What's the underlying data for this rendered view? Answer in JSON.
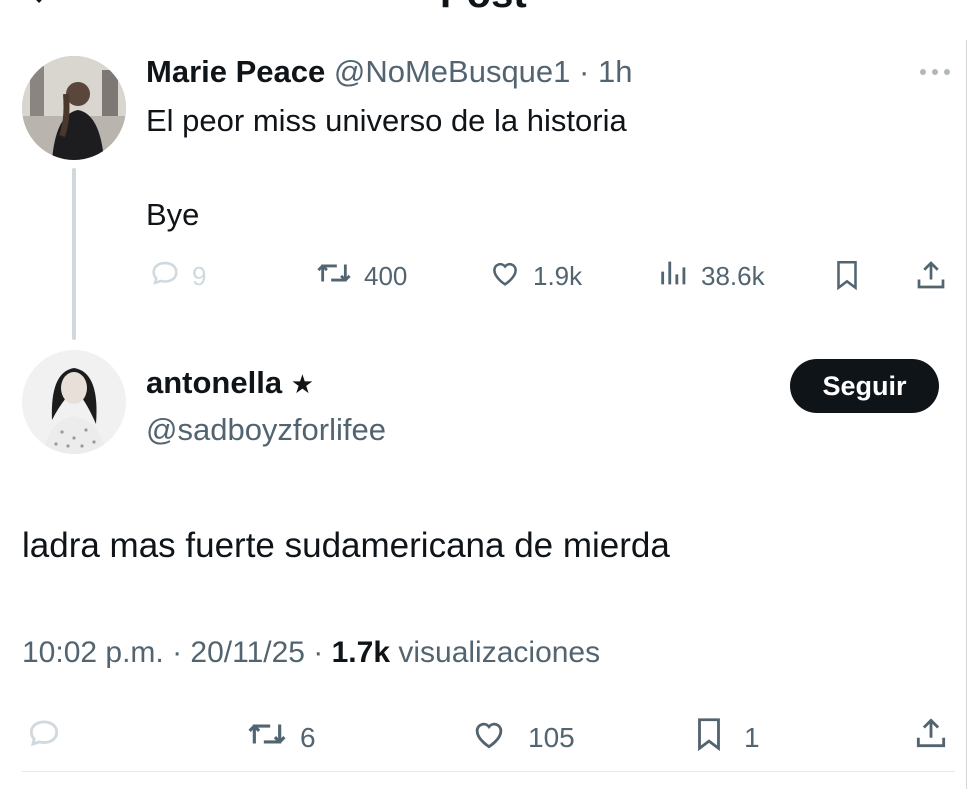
{
  "header": {
    "title": "Post"
  },
  "parent_tweet": {
    "display_name": "Marie Peace",
    "handle": "@NoMeBusque1",
    "time": "· 1h",
    "line1": "El peor miss universo de la historia",
    "line2": "Bye",
    "stats": {
      "replies": "9",
      "reposts": "400",
      "likes": "1.9k",
      "views": "38.6k"
    }
  },
  "main_tweet": {
    "display_name": "antonella",
    "badge": "★",
    "handle": "@sadboyzforlifee",
    "follow_label": "Seguir",
    "text": "ladra mas fuerte sudamericana de mierda",
    "timestamp": "10:02 p.m. · 20/11/25 · ",
    "views_count": "1.7k",
    "views_label": " visualizaciones",
    "stats": {
      "reposts": "6",
      "likes": "105",
      "bookmarks": "1"
    }
  },
  "icons": [
    "back-arrow-icon",
    "more-icon",
    "reply-icon",
    "repost-icon",
    "like-icon",
    "views-icon",
    "bookmark-icon",
    "share-icon"
  ],
  "colors": {
    "text": "#0f1419",
    "muted": "#536471",
    "faded": "#cfd9de",
    "button": "#0f1419"
  }
}
